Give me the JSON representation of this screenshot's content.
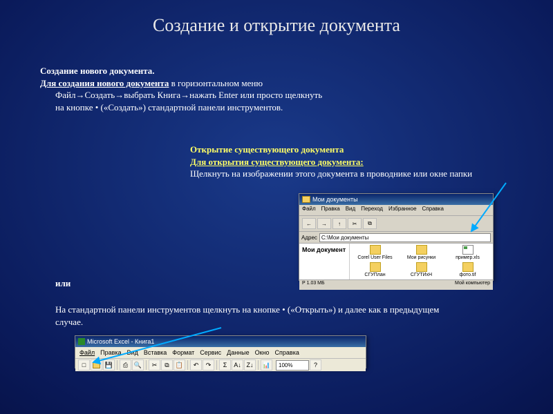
{
  "title": "Создание и открытие документа",
  "section1": {
    "heading": "Создание нового документа.",
    "lead": "Для создания нового документа",
    "tail1": " в горизонтальном меню",
    "line2": "Файл→Создать→выбрать Книга→нажать Enter или просто щелкнуть",
    "line3": "на кнопке • («Создать») стандартной панели инструментов."
  },
  "section2": {
    "heading": "Открытие существующего документа",
    "lead": "Для открытия существующего документа:",
    "body": "Щелкнуть на изображении этого документа в проводнике или окне папки"
  },
  "or": "или",
  "section3": {
    "body": "На стандартной панели инструментов щелкнуть на кнопке • («Открыть») и далее как в предыдущем случае."
  },
  "explorer": {
    "title": "Мои документы",
    "menu": [
      "Файл",
      "Правка",
      "Вид",
      "Переход",
      "Избранное",
      "Справка"
    ],
    "toolbar_labels": [
      "Вверх",
      "Вырез",
      "Копиров"
    ],
    "address_label": "Адрес",
    "address_value": "C:\\Мои документы",
    "side_label": "Мои документ",
    "files": [
      "Corel User Files",
      "Мои рисунки",
      "пример.xls",
      "СГУПлан",
      "СГУТИхН",
      "фото.tif"
    ],
    "status_left": "Р 1.03 МБ",
    "status_right": "Мой компьютер"
  },
  "excel": {
    "title": "Microsoft Excel - Книга1",
    "menu": [
      "Файл",
      "Правка",
      "Вид",
      "Вставка",
      "Формат",
      "Сервис",
      "Данные",
      "Окно",
      "Справка"
    ],
    "zoom": "100%"
  }
}
